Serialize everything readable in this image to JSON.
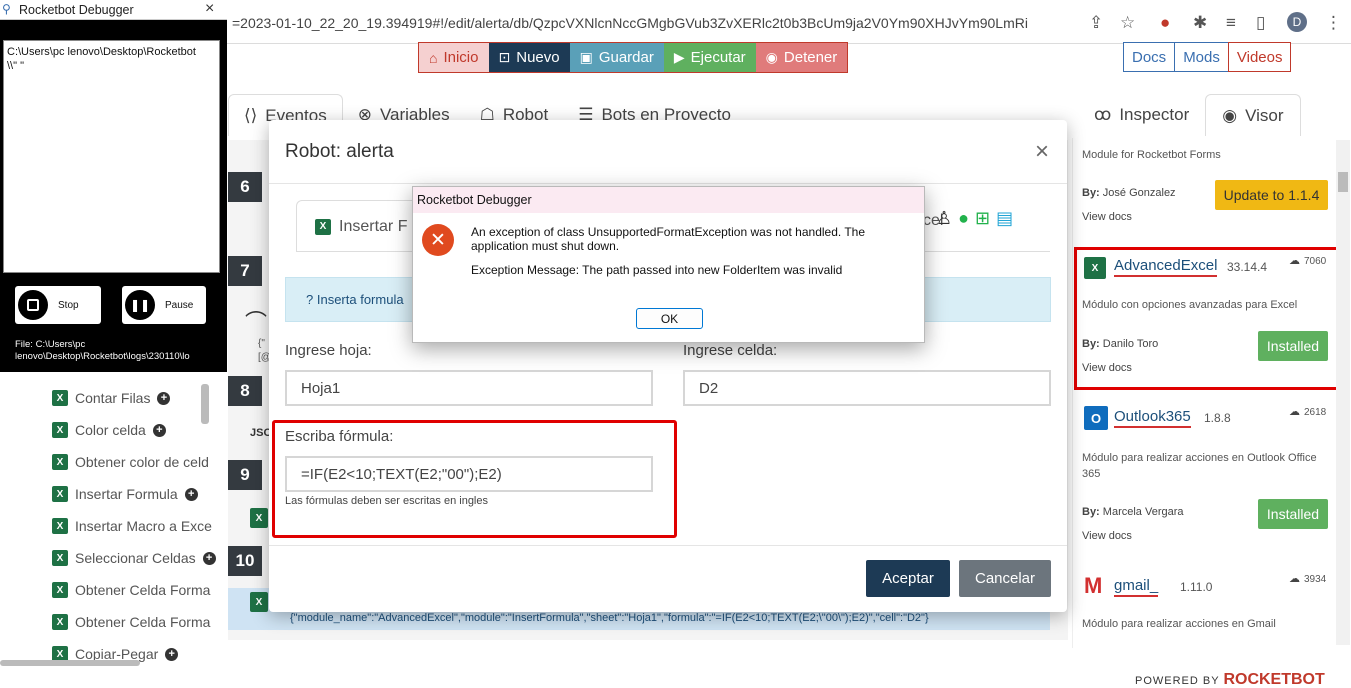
{
  "browser": {
    "url": "=2023-01-10_22_20_19.394919#!/edit/alerta/db/QzpcVXNlcnNccGMgbGVub3ZvXERlc2t0b3BcUm9ja2V0Ym90XHJvYm90LmRi",
    "avatar_letter": "D"
  },
  "toolbar": {
    "inicio": "Inicio",
    "nuevo": "Nuevo",
    "guardar": "Guardar",
    "ejecutar": "Ejecutar",
    "detener": "Detener"
  },
  "links": {
    "docs": "Docs",
    "mods": "Mods",
    "videos": "Videos"
  },
  "tabs": {
    "eventos": "Eventos",
    "variables": "Variables",
    "robot": "Robot",
    "bots": "Bots en Proyecto",
    "inspector": "Inspector",
    "visor": "Visor"
  },
  "row_numbers": [
    "6",
    "7",
    "8",
    "9",
    "10"
  ],
  "row_snippets": {
    "r7a": "{\"",
    "r7b": "[@",
    "r8": "JSO"
  },
  "row10_code": "{\"module_name\":\"AdvancedExcel\",\"module\":\"InsertFormula\",\"sheet\":\"Hoja1\",\"formula\":\"=IF(E2<10;TEXT(E2;\\\"00\\\");E2)\",\"cell\":\"D2\"}",
  "sidebar": {
    "items": [
      {
        "label": "Contar Filas",
        "plus": true
      },
      {
        "label": "Color celda",
        "plus": true
      },
      {
        "label": "Obtener color de celd",
        "plus": false
      },
      {
        "label": "Insertar Formula",
        "plus": true
      },
      {
        "label": "Insertar Macro a Exce",
        "plus": false
      },
      {
        "label": "Seleccionar Celdas",
        "plus": true
      },
      {
        "label": "Obtener Celda Forma",
        "plus": false
      },
      {
        "label": "Obtener Celda Forma",
        "plus": false
      },
      {
        "label": "Copiar-Pegar",
        "plus": true
      }
    ]
  },
  "visor": {
    "mod0_desc": "Module for Rocketbot Forms",
    "mod0_by_label": "By:",
    "mod0_author": "José Gonzalez",
    "mod0_viewdocs": "View docs",
    "mod0_update": "Update to 1.1.4",
    "mod1": {
      "name": "AdvancedExcel",
      "version": "33.14.4",
      "downloads": "7060",
      "desc": "Módulo con opciones avanzadas para Excel",
      "by_label": "By:",
      "author": "Danilo Toro",
      "status": "Installed",
      "viewdocs": "View docs"
    },
    "mod2": {
      "name": "Outlook365",
      "version": "1.8.8",
      "downloads": "2618",
      "desc": "Módulo para realizar acciones en Outlook Office 365",
      "by_label": "By:",
      "author": "Marcela Vergara",
      "status": "Installed",
      "viewdocs": "View docs"
    },
    "mod3": {
      "name": "gmail_",
      "version": "1.11.0",
      "downloads": "3934",
      "desc": "Módulo para realizar acciones en Gmail"
    }
  },
  "footer": {
    "powered": "POWERED BY",
    "brand": "ROCKETBOT"
  },
  "modal": {
    "title": "Robot: alerta",
    "close": "×",
    "tab_label": "Insertar F",
    "tab_label_right": "cel",
    "info": "Inserta formula",
    "sheet_label": "Ingrese hoja:",
    "sheet_value": "Hoja1",
    "cell_label": "Ingrese celda:",
    "cell_value": "D2",
    "formula_label": "Escriba fórmula:",
    "formula_value": "=IF(E2<10;TEXT(E2;\"00\");E2)",
    "hint": "Las fórmulas deben ser escritas en ingles",
    "accept": "Aceptar",
    "cancel": "Cancelar"
  },
  "debugger": {
    "title": "Rocketbot Debugger",
    "close": "×",
    "log_line1": "C:\\Users\\pc lenovo\\Desktop\\Rocketbot",
    "log_line2": "\\\\\" \"",
    "stop": "Stop",
    "pause": "Pause",
    "file_line1": "File: C:\\Users\\pc",
    "file_line2": "lenovo\\Desktop\\Rocketbot\\logs\\230110\\lo"
  },
  "error_dialog": {
    "title": "Rocketbot Debugger",
    "message": "An exception of class UnsupportedFormatException was not handled.  The application must shut down.",
    "detail": "Exception Message: The path passed into new FolderItem was invalid",
    "ok": "OK"
  },
  "colors": {
    "accent": "#1d3a55",
    "highlight": "#e00000",
    "installed": "#5fb05f",
    "update": "#f0b814"
  }
}
